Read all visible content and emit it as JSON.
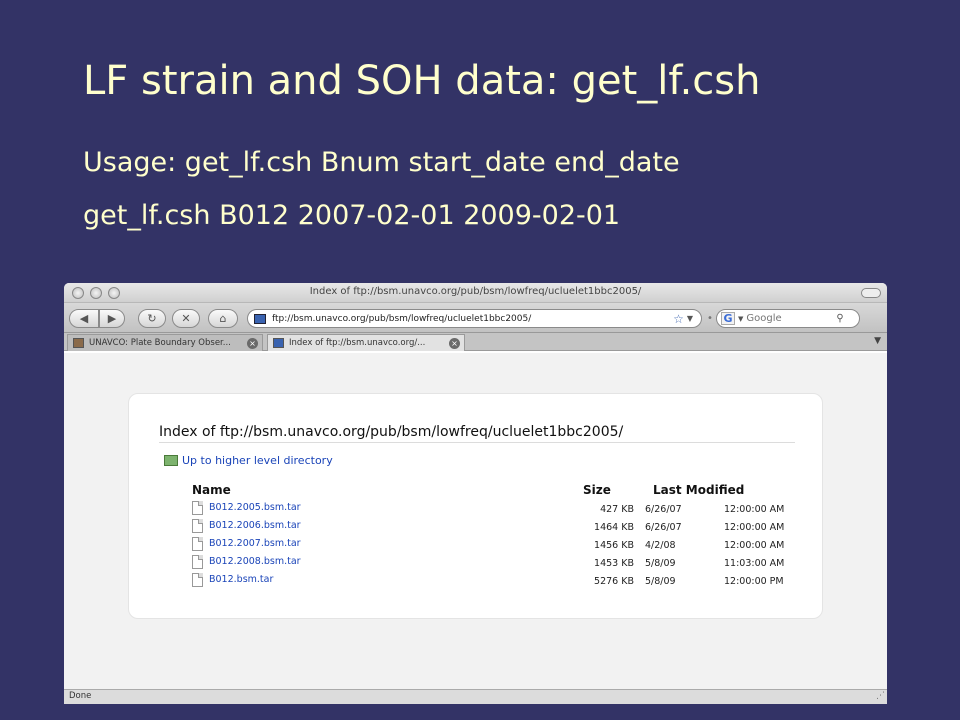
{
  "slide": {
    "title": "LF strain and SOH data:  get_lf.csh",
    "usage_line": "Usage: get_lf.csh Bnum start_date end_date",
    "example_line": "get_lf.csh B012 2007-02-01 2009-02-01"
  },
  "browser": {
    "window_title": "Index of ftp://bsm.unavco.org/pub/bsm/lowfreq/ucluelet1bbc2005/",
    "url": "ftp://bsm.unavco.org/pub/bsm/lowfreq/ucluelet1bbc2005/",
    "search_placeholder": "Google",
    "tabs": [
      {
        "label": "UNAVCO: Plate Boundary Obser...",
        "active": false
      },
      {
        "label": "Index of ftp://bsm.unavco.org/...",
        "active": true
      }
    ],
    "status": "Done"
  },
  "listing": {
    "heading": "Index of ftp://bsm.unavco.org/pub/bsm/lowfreq/ucluelet1bbc2005/",
    "up_link": "Up to higher level directory",
    "columns": {
      "name": "Name",
      "size": "Size",
      "modified": "Last Modified"
    },
    "files": [
      {
        "name": "B012.2005.bsm.tar",
        "size": "427 KB",
        "date": "6/26/07",
        "time": "12:00:00 AM"
      },
      {
        "name": "B012.2006.bsm.tar",
        "size": "1464 KB",
        "date": "6/26/07",
        "time": "12:00:00 AM"
      },
      {
        "name": "B012.2007.bsm.tar",
        "size": "1456 KB",
        "date": "4/2/08",
        "time": "12:00:00 AM"
      },
      {
        "name": "B012.2008.bsm.tar",
        "size": "1453 KB",
        "date": "5/8/09",
        "time": "11:03:00 AM"
      },
      {
        "name": "B012.bsm.tar",
        "size": "5276 KB",
        "date": "5/8/09",
        "time": "12:00:00 PM"
      }
    ]
  },
  "colors": {
    "slide_background": "#333366",
    "slide_text": "#FFFFCC",
    "link": "#1a44b8"
  }
}
